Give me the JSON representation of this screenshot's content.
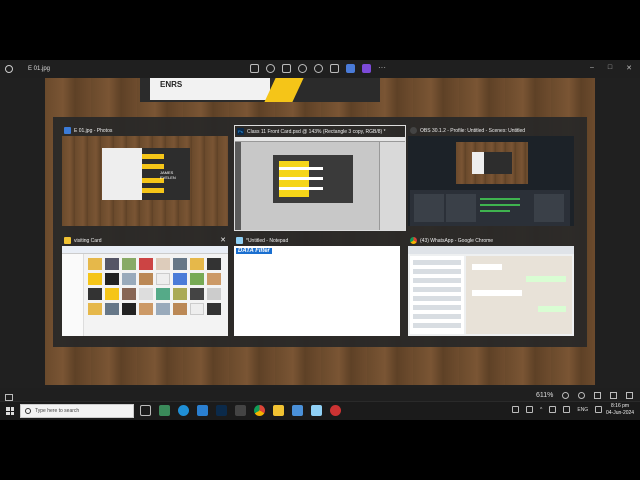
{
  "photos_app": {
    "window_title": "E 01.jpg",
    "zoom_level": "611%",
    "window_controls": {
      "minimize": "–",
      "maximize": "□",
      "close": "✕"
    },
    "more_label": "···"
  },
  "photo_content": {
    "brand_text": "ENRS"
  },
  "task_view": {
    "windows": [
      {
        "title": "E 01.jpg - Photos",
        "icon": "photos-icon",
        "card_name": "JAMES EVELEN"
      },
      {
        "title": "Class 11 Front Card.psd @ 143% (Rectangle 3 copy, RGB/8) *",
        "icon": "photoshop-icon",
        "icon_label": "Ps"
      },
      {
        "title": "OBS 30.1.2 - Profile: Untitled - Scenes: Untitled",
        "icon": "obs-icon"
      },
      {
        "title": "visiting Card",
        "icon": "folder-icon",
        "close": "✕"
      },
      {
        "title": "*Untitled - Notepad",
        "icon": "notepad-icon",
        "content": "DATA Filter"
      },
      {
        "title": "(43) WhatsApp - Google Chrome",
        "icon": "chrome-icon"
      }
    ]
  },
  "taskbar": {
    "search_placeholder": "Type here to search",
    "tray_lang": "ENG",
    "time": "8:16 pm",
    "date": "04-Jun-2024"
  },
  "colors": {
    "accent_yellow": "#f5c518",
    "wood": "#6a4a2c",
    "taskbar": "#1b1b1b"
  }
}
